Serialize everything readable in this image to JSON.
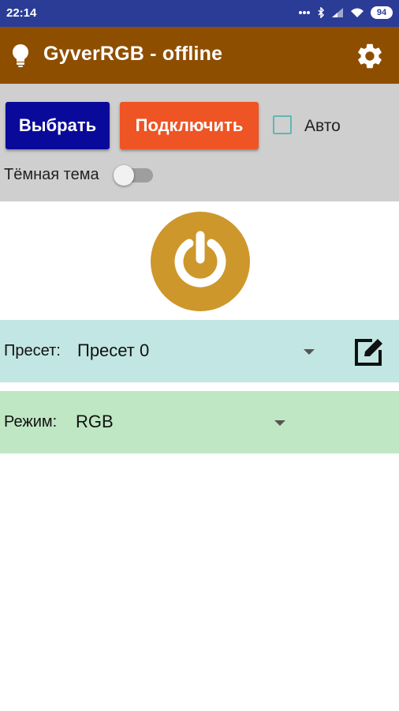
{
  "status_bar": {
    "time": "22:14",
    "battery": "94",
    "icons": [
      "dots-icon",
      "bluetooth-icon",
      "signal-icon",
      "wifi-icon",
      "battery-icon"
    ]
  },
  "app_bar": {
    "title": "GyverRGB - offline",
    "icons": [
      "bulb-icon",
      "gear-icon"
    ],
    "color": "#8e4e00"
  },
  "controls": {
    "select_label": "Выбрать",
    "connect_label": "Подключить",
    "auto_label": "Авто",
    "auto_checked": false,
    "dark_theme_label": "Тёмная тема",
    "dark_theme_on": false,
    "colors": {
      "select": "#0a0a9a",
      "connect": "#ee5424",
      "panel": "#cfcfcf"
    }
  },
  "power": {
    "icon": "power-icon",
    "color": "#cd972c"
  },
  "preset": {
    "label": "Пресет:",
    "value": "Пресет 0",
    "edit_icon": "edit-icon",
    "color": "#c2e6e3"
  },
  "mode": {
    "label": "Режим:",
    "value": "RGB",
    "color": "#bfe7c3"
  }
}
